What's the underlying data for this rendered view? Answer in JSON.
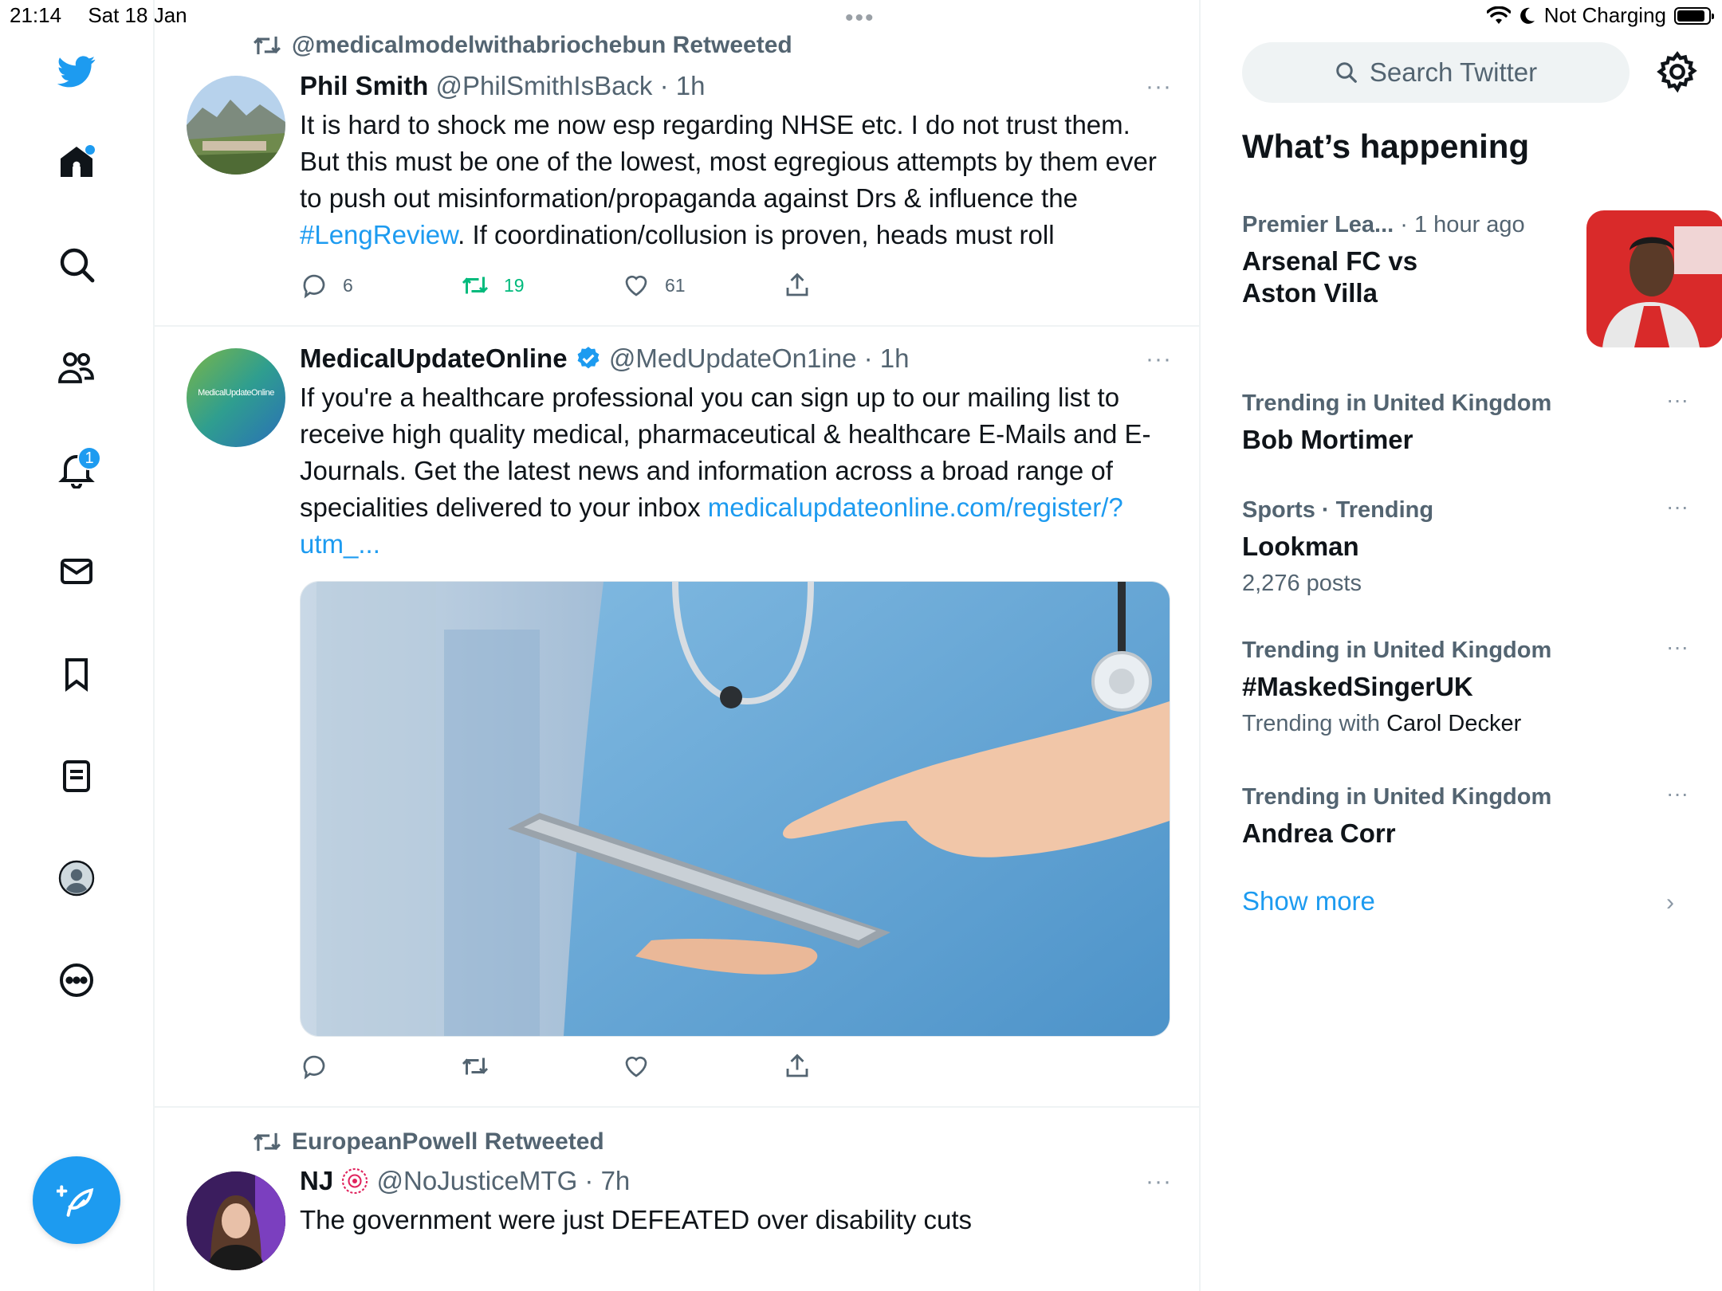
{
  "status": {
    "time": "21:14",
    "date": "Sat 18 Jan",
    "dots": "•••",
    "charging": "Not Charging"
  },
  "nav": {
    "notifications_badge": "1"
  },
  "colors": {
    "accent": "#1d9bf0",
    "retweet_green": "#00ba7c",
    "secondary_text": "#536471"
  },
  "tweets": [
    {
      "retweeted_by": "@medicalmodelwithabriochebun Retweeted",
      "name": "Phil Smith",
      "handle": "@PhilSmithIsBack",
      "time": "· 1h",
      "more": "···",
      "text_before": "It is hard to shock me now esp regarding NHSE etc. I do not trust them. But this must be one of the lowest, most egregious attempts by them ever to push out misinformation/propaganda against Drs & influence the ",
      "hashtag": "#LengReview",
      "text_after": ". If coordination/collusion is proven, heads must roll",
      "replies": "6",
      "retweets": "19",
      "likes": "61"
    },
    {
      "name": "MedicalUpdateOnline",
      "handle": "@MedUpdateOn1ine",
      "time": "· 1h",
      "more": "···",
      "avatar_text": "MedicalUpdateOnline",
      "text": "If you're a healthcare professional you can sign up to our mailing list to receive high quality medical, pharmaceutical & healthcare E-Mails and E-Journals. Get the latest news and information across a broad range of specialities delivered to your inbox ",
      "link": "medicalupdateonline.com/register/?utm_..."
    },
    {
      "retweeted_by": "EuropeanPowell Retweeted",
      "name": "NJ",
      "handle": "@NoJusticeMTG",
      "time": "· 7h",
      "more": "···",
      "text": "The government were just DEFEATED over disability cuts"
    }
  ],
  "sidebar": {
    "search_placeholder": "Search Twitter",
    "title": "What’s happening",
    "trends": [
      {
        "category": "Premier Lea...",
        "time": "· 1 hour ago",
        "title_line1": "Arsenal FC vs",
        "title_line2": "Aston Villa"
      },
      {
        "category": "Trending in United Kingdom",
        "title": "Bob Mortimer",
        "more": "···"
      },
      {
        "category": "Sports · Trending",
        "title": "Lookman",
        "sub": "2,276 posts",
        "more": "···"
      },
      {
        "category": "Trending in United Kingdom",
        "title": "#MaskedSingerUK",
        "sub_prefix": "Trending with",
        "sub_name": "Carol Decker",
        "more": "···"
      },
      {
        "category": "Trending in United Kingdom",
        "title": "Andrea Corr",
        "more": "···"
      }
    ],
    "show_more": "Show more",
    "chevron": "›"
  }
}
